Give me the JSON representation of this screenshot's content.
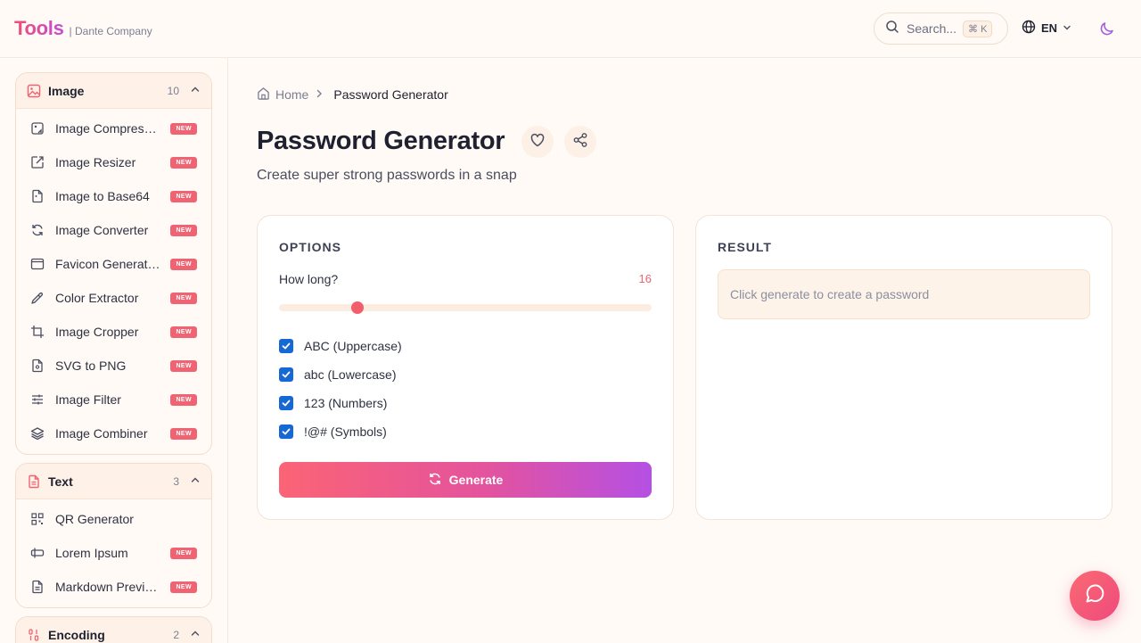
{
  "brand": {
    "logo": "Tools",
    "company": "| Dante Company"
  },
  "search": {
    "placeholder": "Search...",
    "shortcut": "⌘ K"
  },
  "language": {
    "code": "EN"
  },
  "sidebar": {
    "groups": [
      {
        "title": "Image",
        "count": "10",
        "items": [
          {
            "label": "Image Compres…",
            "badge": "NEW"
          },
          {
            "label": "Image Resizer",
            "badge": "NEW"
          },
          {
            "label": "Image to Base64",
            "badge": "NEW"
          },
          {
            "label": "Image Converter",
            "badge": "NEW"
          },
          {
            "label": "Favicon Generat…",
            "badge": "NEW"
          },
          {
            "label": "Color Extractor",
            "badge": "NEW"
          },
          {
            "label": "Image Cropper",
            "badge": "NEW"
          },
          {
            "label": "SVG to PNG",
            "badge": "NEW"
          },
          {
            "label": "Image Filter",
            "badge": "NEW"
          },
          {
            "label": "Image Combiner",
            "badge": "NEW"
          }
        ]
      },
      {
        "title": "Text",
        "count": "3",
        "items": [
          {
            "label": "QR Generator",
            "badge": ""
          },
          {
            "label": "Lorem Ipsum",
            "badge": "NEW"
          },
          {
            "label": "Markdown Previ…",
            "badge": "NEW"
          }
        ]
      },
      {
        "title": "Encoding",
        "count": "2",
        "items": []
      }
    ]
  },
  "breadcrumb": {
    "home": "Home",
    "current": "Password Generator"
  },
  "page": {
    "title": "Password Generator",
    "subtitle": "Create super strong passwords in a snap"
  },
  "options": {
    "title": "OPTIONS",
    "length_label": "How long?",
    "length_value": "16",
    "length_fraction": 0.21,
    "checks": [
      {
        "label": "ABC (Uppercase)",
        "checked": true
      },
      {
        "label": "abc (Lowercase)",
        "checked": true
      },
      {
        "label": "123 (Numbers)",
        "checked": true
      },
      {
        "label": "!@# (Symbols)",
        "checked": true
      }
    ],
    "generate_label": "Generate"
  },
  "result": {
    "title": "RESULT",
    "placeholder": "Click generate to create a password"
  },
  "colors": {
    "accent": "#f06372",
    "checkbox": "#1668d4",
    "brand_start": "#ef4f76",
    "brand_end": "#c24bd8"
  }
}
